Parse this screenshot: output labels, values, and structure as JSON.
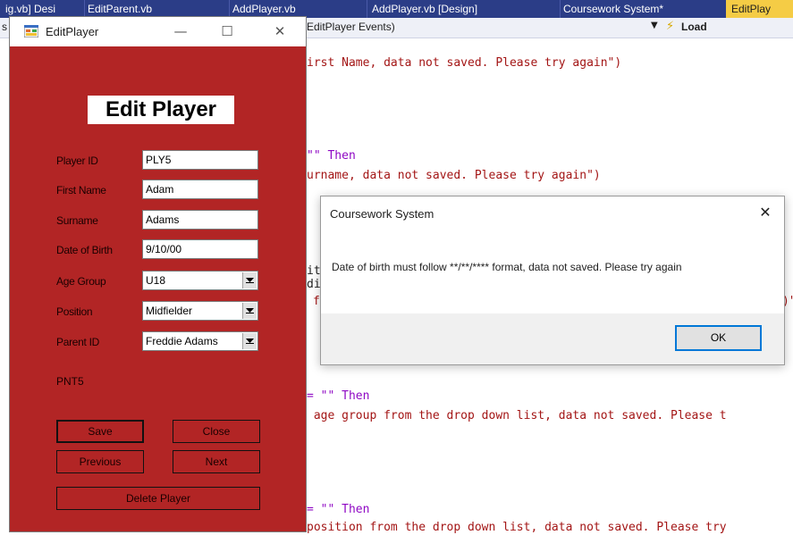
{
  "vs": {
    "tabs": [
      {
        "label": "ig.vb]  Desi"
      },
      {
        "label": "EditParent.vb"
      },
      {
        "label": "AddPlayer.vb"
      },
      {
        "label": "AddPlayer.vb [Design]"
      },
      {
        "label": "Coursework System*"
      },
      {
        "label": "EditPlay"
      }
    ],
    "nav_left_fragment": "s",
    "nav_events": "EditPlayer Events)",
    "nav_method": "Load",
    "code_lines": [
      {
        "kind": "str",
        "text": "irst Name, data not saved. Please try again\")"
      },
      {
        "kind": "kw",
        "text": "\"\" Then"
      },
      {
        "kind": "str",
        "text": "urname, data not saved. Please try again\")"
      },
      {
        "kind": "plain",
        "text": "it"
      },
      {
        "kind": "plain",
        "text": "di"
      },
      {
        "kind": "str",
        "text": "f"
      },
      {
        "kind": "str",
        "text": ")\""
      },
      {
        "kind": "kw",
        "text": "= \"\" Then"
      },
      {
        "kind": "str",
        "text": " age group from the drop down list, data not saved. Please t"
      },
      {
        "kind": "kw",
        "text": "= \"\" Then"
      },
      {
        "kind": "str",
        "text": "position from the drop down list, data not saved. Please try"
      }
    ]
  },
  "edit_player": {
    "window_title": "EditPlayer",
    "minimize_glyph": "—",
    "maximize_glyph": "☐",
    "close_glyph": "✕",
    "heading": "Edit Player",
    "fields": {
      "player_id": {
        "label": "Player ID",
        "value": "PLY5"
      },
      "first_name": {
        "label": "First Name",
        "value": "Adam"
      },
      "surname": {
        "label": "Surname",
        "value": "Adams"
      },
      "dob": {
        "label": "Date of Birth",
        "value": "9/10/00"
      },
      "age_group": {
        "label": "Age Group",
        "value": "U18"
      },
      "position": {
        "label": "Position",
        "value": "Midfielder"
      },
      "parent_id": {
        "label": "Parent ID",
        "value": "Freddie Adams"
      }
    },
    "parent_id_value": "PNT5",
    "buttons": {
      "save": "Save",
      "close": "Close",
      "previous": "Previous",
      "next": "Next",
      "delete": "Delete Player"
    },
    "colors": {
      "form_bg": "#b22525"
    }
  },
  "message_box": {
    "title": "Coursework System",
    "close_glyph": "✕",
    "message": "Date of birth must follow **/**/**** format, data not saved. Please try again",
    "ok_label": "OK"
  }
}
